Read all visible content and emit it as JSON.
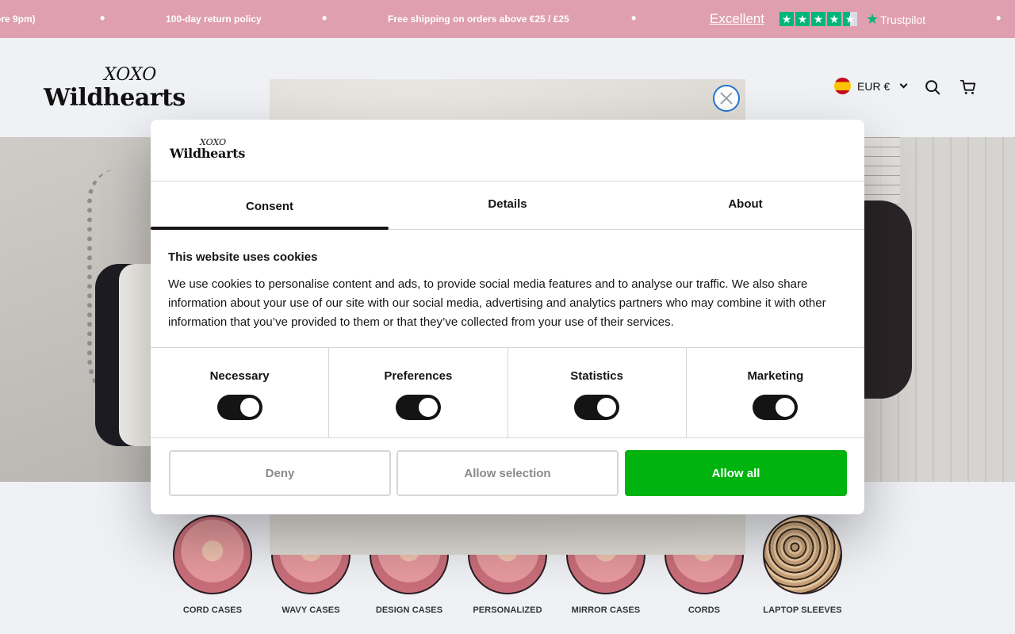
{
  "announcement": {
    "items": [
      "ore 9pm)",
      "100-day return policy",
      "Free shipping on orders above €25 / £25"
    ],
    "trustpilot_rating_text": "Excellent",
    "trustpilot_brand": "Trustpilot",
    "trustpilot_stars": 4.5,
    "bg_color": "#df9fae"
  },
  "header": {
    "logo_top": "XOXO",
    "logo_main": "Wildhearts",
    "currency": "EUR €",
    "icons": [
      "flag-spain-icon",
      "chevron-down-icon",
      "search-icon",
      "cart-icon"
    ]
  },
  "categories": [
    {
      "label": "CORD CASES"
    },
    {
      "label": "WAVY CASES"
    },
    {
      "label": "DESIGN CASES"
    },
    {
      "label": "PERSONALIZED"
    },
    {
      "label": "MIRROR CASES"
    },
    {
      "label": "CORDS"
    },
    {
      "label": "LAPTOP SLEEVES"
    }
  ],
  "cookie_dialog": {
    "logo_top": "XOXO",
    "logo_main": "Wildhearts",
    "tabs": [
      {
        "label": "Consent",
        "active": true
      },
      {
        "label": "Details",
        "active": false
      },
      {
        "label": "About",
        "active": false
      }
    ],
    "title": "This website uses cookies",
    "text": "We use cookies to personalise content and ads, to provide social media features and to analyse our traffic. We also share information about your use of our site with our social media, advertising and analytics partners who may combine it with other information that you’ve provided to them or that they’ve collected from your use of their services.",
    "toggles": [
      {
        "label": "Necessary",
        "on": true
      },
      {
        "label": "Preferences",
        "on": true
      },
      {
        "label": "Statistics",
        "on": true
      },
      {
        "label": "Marketing",
        "on": true
      }
    ],
    "buttons": {
      "deny": "Deny",
      "allow_selection": "Allow selection",
      "allow_all": "Allow all"
    },
    "primary_color": "#00b30f"
  }
}
